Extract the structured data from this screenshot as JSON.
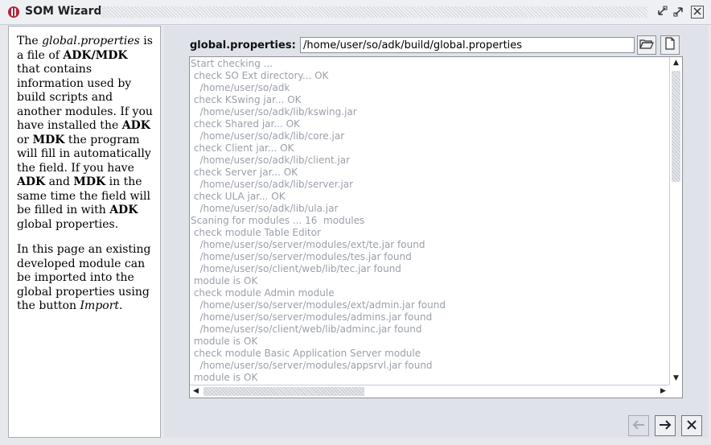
{
  "window": {
    "title": "SOM Wizard",
    "buttons": [
      "minimize",
      "maximize",
      "close"
    ]
  },
  "help_panel": {
    "paragraph1": [
      {
        "text": "The ",
        "style": "normal"
      },
      {
        "text": "global.properties",
        "style": "italic"
      },
      {
        "text": " is a file of ",
        "style": "normal"
      },
      {
        "text": "ADK/MDK",
        "style": "bold"
      },
      {
        "text": " that contains information used by build scripts and another modules. If you have installed the ",
        "style": "normal"
      },
      {
        "text": "ADK",
        "style": "bold"
      },
      {
        "text": " or ",
        "style": "normal"
      },
      {
        "text": "MDK",
        "style": "bold"
      },
      {
        "text": " the program will fill in automatically the field. If you have ",
        "style": "normal"
      },
      {
        "text": "ADK",
        "style": "bold"
      },
      {
        "text": " and ",
        "style": "normal"
      },
      {
        "text": "MDK",
        "style": "bold"
      },
      {
        "text": " in the same time the field will be filled in with ",
        "style": "normal"
      },
      {
        "text": "ADK",
        "style": "bold"
      },
      {
        "text": " global properties.",
        "style": "normal"
      }
    ],
    "paragraph2": [
      {
        "text": "In this page an existing developed module can be imported into the global properties using the button ",
        "style": "normal"
      },
      {
        "text": "Import",
        "style": "italic"
      },
      {
        "text": ".",
        "style": "normal"
      }
    ]
  },
  "properties": {
    "label": "global.properties:",
    "path_value": "/home/user/so/adk/build/global.properties",
    "browse_icon": "folder-open-icon",
    "new_icon": "new-file-icon"
  },
  "log": {
    "lines": [
      "Start checking ...",
      " check SO Ext directory... OK",
      "   /home/user/so/adk",
      " check KSwing jar... OK",
      "   /home/user/so/adk/lib/kswing.jar",
      " check Shared jar... OK",
      "   /home/user/so/adk/lib/core.jar",
      " check Client jar... OK",
      "   /home/user/so/adk/lib/client.jar",
      " check Server jar... OK",
      "   /home/user/so/adk/lib/server.jar",
      " check ULA jar... OK",
      "   /home/user/so/adk/lib/ula.jar",
      "Scaning for modules ... 16  modules",
      " check module Table Editor",
      "   /home/user/so/server/modules/ext/te.jar found",
      "   /home/user/so/server/modules/tes.jar found",
      "   /home/user/so/client/web/lib/tec.jar found",
      " module is OK",
      " check module Admin module",
      "   /home/user/so/server/modules/ext/admin.jar found",
      "   /home/user/so/server/modules/admins.jar found",
      "   /home/user/so/client/web/lib/adminc.jar found",
      " module is OK",
      " check module Basic Application Server module",
      "   /home/user/so/server/modules/appsrvl.jar found",
      " module is OK"
    ]
  },
  "nav": {
    "back_icon": "arrow-left-icon",
    "next_icon": "arrow-right-icon",
    "cancel_icon": "close-icon",
    "back_enabled": false
  }
}
